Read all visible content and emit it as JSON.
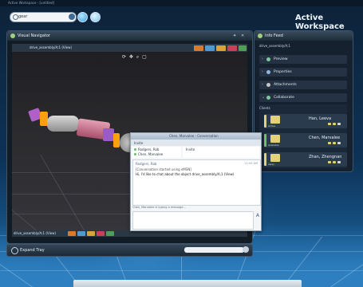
{
  "window": {
    "title": "Active Workspace - [untitled]"
  },
  "header": {
    "search_value": "gear",
    "workspace_title": "Active Workspace"
  },
  "visual_navigator": {
    "title": "Visual Navigator",
    "tab_label": "drive_assembly/A;1 (View)",
    "bottom_tab_label": "drive_assembly/A;1 (View)",
    "nav_glyphs": "⟳ ✥ ⌕ ▢"
  },
  "expand_tray": {
    "label": "Expand Tray"
  },
  "side_panel": {
    "title": "Info Feed",
    "subtitle": "drive_assembly/A;1",
    "sections": [
      {
        "label": "Preview"
      },
      {
        "label": "Properties"
      },
      {
        "label": "Attachments"
      },
      {
        "label": "Collaborate"
      }
    ],
    "clients_label": "Clients",
    "clients": [
      {
        "name": "Han, Leeva",
        "label": "Active",
        "bar_color": "#e6d36e"
      },
      {
        "name": "Chen, Marvalee",
        "label": "Available",
        "bar_color": "#6cc46c"
      },
      {
        "name": "Zhan, Zhengnan",
        "label": "Away",
        "bar_color": "#e6d36e"
      }
    ]
  },
  "conversation": {
    "title": "Chen, Marvalee - Conversation",
    "toolbar_label": "Invite",
    "participants": [
      "Rodgers, Rob",
      "Chen, Marvalee"
    ],
    "right_tool_label": "Invite",
    "log_header": "Rodgers, Rob",
    "log_time": "11:09 AM",
    "log_lines": [
      "[Conversation started using eMSN]",
      "Hi, I'd like to chat about the object drive_assembly/A;1 (View)"
    ],
    "status": "Chen, Marvalee is typing a message..."
  },
  "colors": {
    "accent": "#2f7fc1",
    "status_available": "#6cc46c",
    "status_active": "#e6d36e"
  },
  "icons": [
    "search-icon",
    "go-icon",
    "forward-icon",
    "globe-icon",
    "navigator-icon",
    "infofeed-icon",
    "expand-icon",
    "close-icon"
  ]
}
